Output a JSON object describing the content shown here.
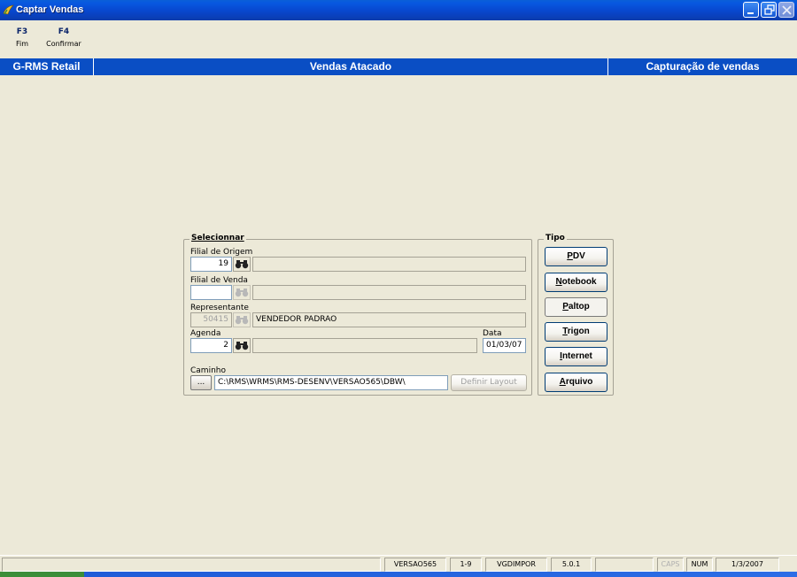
{
  "window": {
    "title": "Captar Vendas"
  },
  "function_keys": [
    {
      "key": "F3",
      "label": "Fim"
    },
    {
      "key": "F4",
      "label": "Confirmar"
    }
  ],
  "header": {
    "left": "G-RMS Retail",
    "center": "Vendas Atacado",
    "right": "Capturação de vendas"
  },
  "selecionar": {
    "legend": "Selecionnar",
    "filial_origem": {
      "label": "Filial de Origem",
      "value": "19",
      "description": ""
    },
    "filial_venda": {
      "label": "Filial de Venda",
      "value": "",
      "description": ""
    },
    "representante": {
      "label": "Representante",
      "value": "50415",
      "description": "VENDEDOR PADRAO"
    },
    "agenda": {
      "label": "Agenda",
      "value": "2",
      "description": ""
    },
    "data": {
      "label": "Data",
      "value": "01/03/07"
    },
    "caminho": {
      "label": "Caminho",
      "browse_label": "...",
      "value": "C:\\RMS\\WRMS\\RMS-DESENV\\VERSAO565\\DBW\\",
      "layout_button": "Definir Layout"
    }
  },
  "tipo": {
    "legend": "Tipo",
    "buttons": [
      {
        "label": "PDV"
      },
      {
        "label": "Notebook"
      },
      {
        "label": "Paltop"
      },
      {
        "label": "Trigon"
      },
      {
        "label": "Internet"
      },
      {
        "label": "Arquivo"
      }
    ]
  },
  "status": {
    "version": "VERSAO565",
    "range": "1-9",
    "db": "VGDIMPOR",
    "release": "5.0.1",
    "caps": "CAPS",
    "num": "NUM",
    "date": "1/3/2007"
  },
  "colors": {
    "title_bar": "#0A4EC4",
    "header_bar": "#0A4EC4",
    "window_bg": "#ECE9D8"
  }
}
